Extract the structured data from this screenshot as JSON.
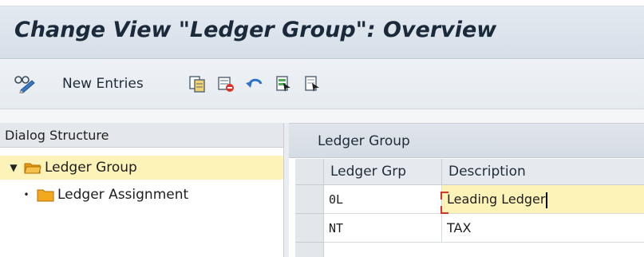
{
  "window": {
    "title": "Change View \"Ledger Group\": Overview"
  },
  "toolbar": {
    "items": [
      {
        "icon": "glasses-pencil-icon"
      },
      {
        "label": "New Entries"
      },
      {
        "icon": "copy-as-icon"
      },
      {
        "icon": "delete-icon"
      },
      {
        "icon": "undo-change-icon"
      },
      {
        "icon": "select-all-icon"
      },
      {
        "icon": "deselect-all-icon"
      }
    ]
  },
  "dialog_structure": {
    "header": "Dialog Structure",
    "items": [
      {
        "label": "Ledger Group",
        "selected": true,
        "marker": "▼"
      },
      {
        "label": "Ledger Assignment",
        "selected": false,
        "marker": "•"
      }
    ]
  },
  "table": {
    "title": "Ledger Group",
    "columns": [
      "Ledger Grp",
      "Description"
    ],
    "rows": [
      {
        "ledger_grp": "0L",
        "description": "Leading Ledger",
        "focused": true
      },
      {
        "ledger_grp": "NT",
        "description": "TAX",
        "focused": false
      }
    ]
  },
  "colors": {
    "selection_yellow": "#fdf3b8",
    "folder_orange": "#f3a81d",
    "title_text": "#1b2a3a",
    "required_marker": "#d9342b"
  }
}
